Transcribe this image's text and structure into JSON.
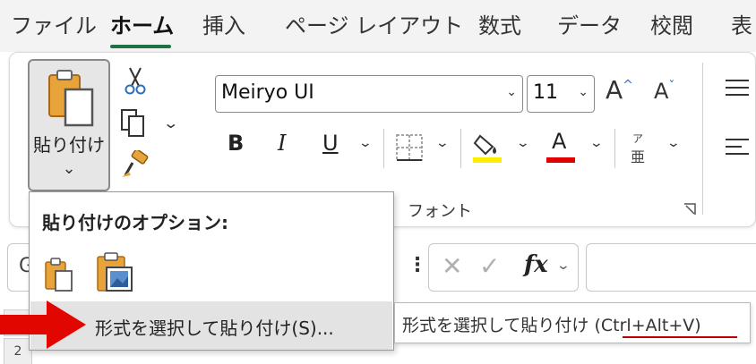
{
  "menu": {
    "tabs": [
      {
        "label": "ファイル"
      },
      {
        "label": "ホーム"
      },
      {
        "label": "挿入"
      },
      {
        "label": "ページ レイアウト"
      },
      {
        "label": "数式"
      },
      {
        "label": "データ"
      },
      {
        "label": "校閲"
      },
      {
        "label": "表"
      }
    ],
    "active_tab": "ホーム",
    "active_color": "#1e7145"
  },
  "clipboard": {
    "paste_label": "貼り付け"
  },
  "font": {
    "name": "Meiryo UI",
    "size": "11",
    "group_label": "フォント",
    "bold": "B",
    "italic": "I",
    "underline": "U",
    "font_color_glyph": "A",
    "phonetic_top": "ア",
    "phonetic_bottom": "亜",
    "highlight_color": "#ffee00",
    "font_color": "#e00000"
  },
  "formula_bar": {
    "name_box_value": "G",
    "fx_label": "fx"
  },
  "sheet": {
    "row_headers": [
      "",
      "2"
    ]
  },
  "paste_menu": {
    "header": "貼り付けのオプション:",
    "special_item_label": "形式を選択して貼り付け(S)..."
  },
  "tooltip": {
    "text": "形式を選択して貼り付け (Ctrl+Alt+V)"
  },
  "annotation": {
    "arrow_color": "#e10600"
  }
}
